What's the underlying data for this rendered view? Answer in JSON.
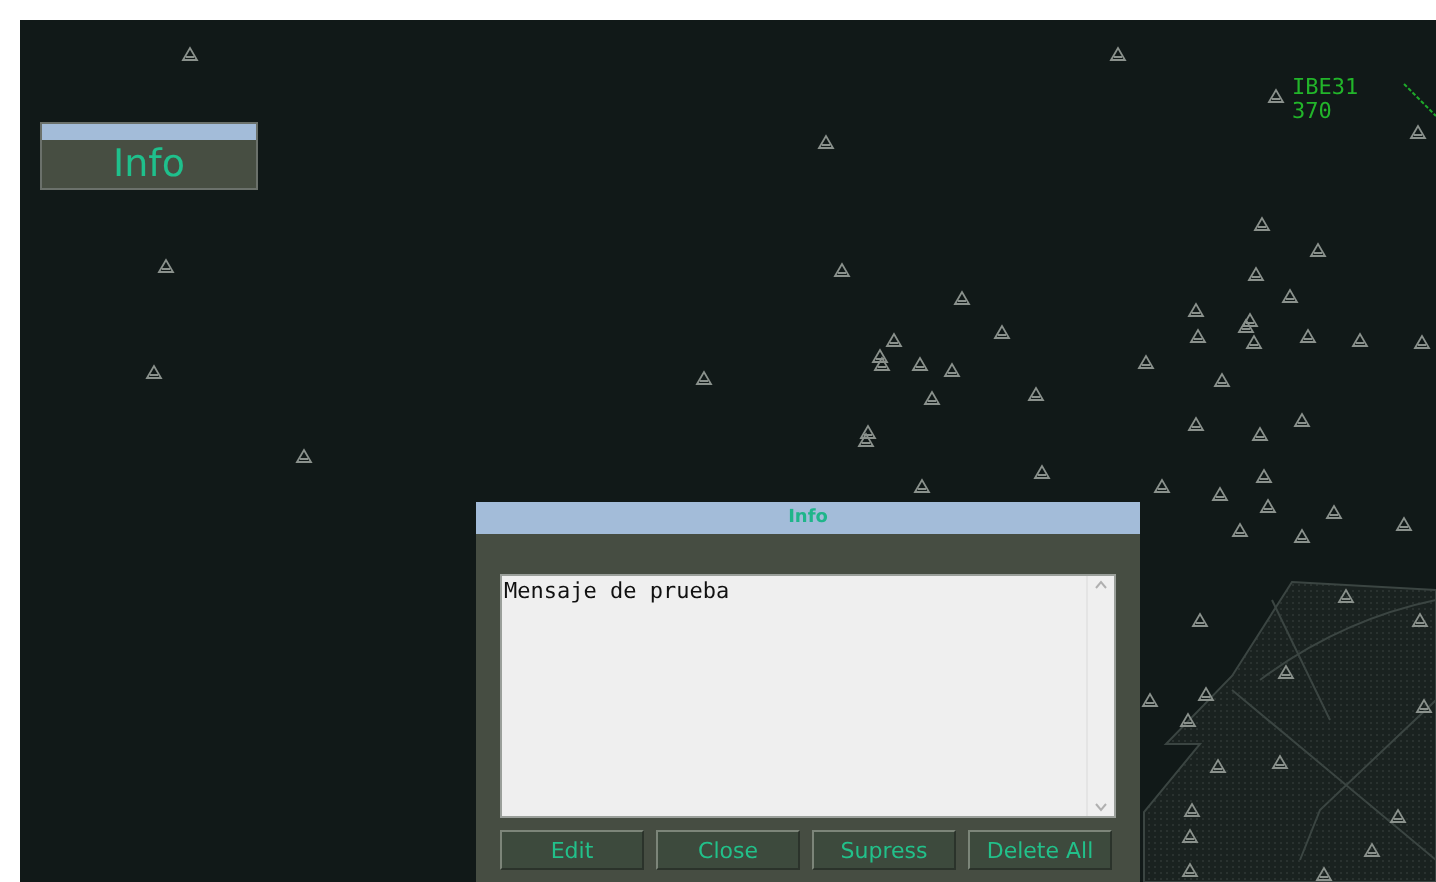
{
  "info_button": {
    "label": "Info"
  },
  "aircraft_label": {
    "callsign": "IBE31",
    "flight_level": "370"
  },
  "dialog": {
    "title": "Info",
    "message": "Mensaje de prueba",
    "buttons": [
      {
        "label": "Edit"
      },
      {
        "label": "Close"
      },
      {
        "label": "Supress"
      },
      {
        "label": "Delete All"
      }
    ]
  }
}
